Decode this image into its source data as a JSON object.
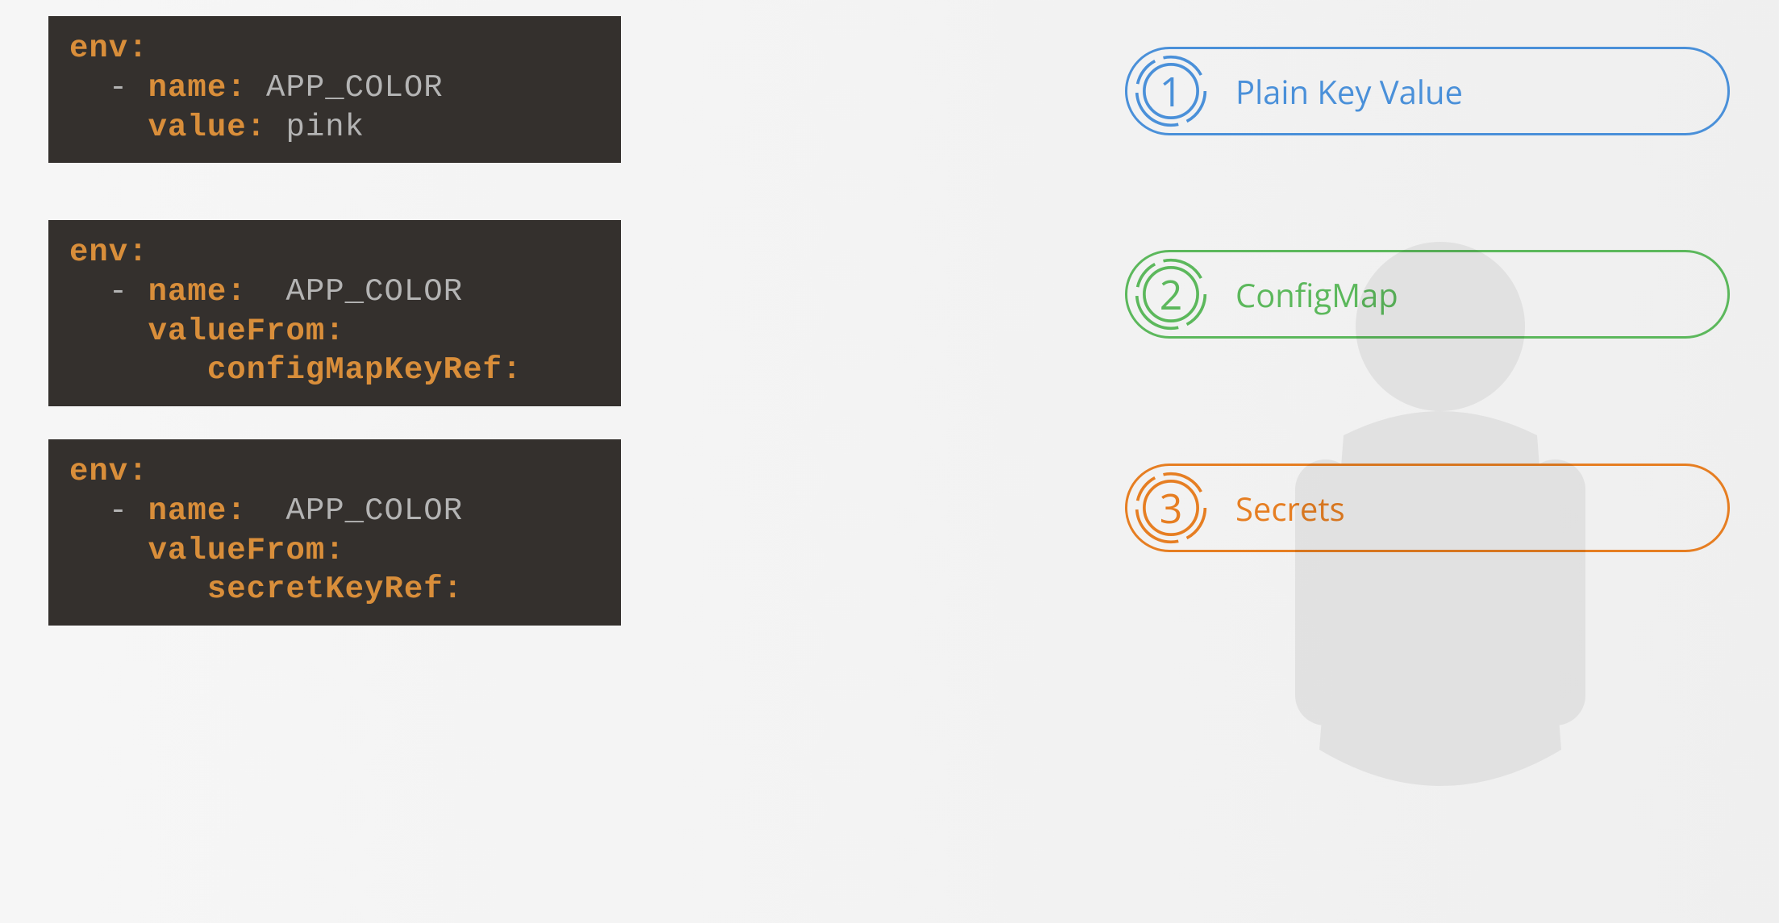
{
  "blocks": [
    {
      "lines": [
        {
          "segments": [
            {
              "cls": "k",
              "t": "env:"
            }
          ]
        },
        {
          "segments": [
            {
              "cls": "v",
              "t": "  - "
            },
            {
              "cls": "k",
              "t": "name:"
            },
            {
              "cls": "v",
              "t": " APP_COLOR"
            }
          ]
        },
        {
          "segments": [
            {
              "cls": "v",
              "t": "    "
            },
            {
              "cls": "k",
              "t": "value:"
            },
            {
              "cls": "v",
              "t": " pink"
            }
          ]
        }
      ]
    },
    {
      "lines": [
        {
          "segments": [
            {
              "cls": "k",
              "t": "env:"
            }
          ]
        },
        {
          "segments": [
            {
              "cls": "v",
              "t": "  - "
            },
            {
              "cls": "k",
              "t": "name:"
            },
            {
              "cls": "v",
              "t": "  APP_COLOR"
            }
          ]
        },
        {
          "segments": [
            {
              "cls": "v",
              "t": "    "
            },
            {
              "cls": "k",
              "t": "valueFrom:"
            }
          ]
        },
        {
          "segments": [
            {
              "cls": "v",
              "t": "       "
            },
            {
              "cls": "k",
              "t": "configMapKeyRef:"
            }
          ]
        }
      ]
    },
    {
      "lines": [
        {
          "segments": [
            {
              "cls": "k",
              "t": "env:"
            }
          ]
        },
        {
          "segments": [
            {
              "cls": "v",
              "t": "  - "
            },
            {
              "cls": "k",
              "t": "name:"
            },
            {
              "cls": "v",
              "t": "  APP_COLOR"
            }
          ]
        },
        {
          "segments": [
            {
              "cls": "v",
              "t": "    "
            },
            {
              "cls": "k",
              "t": "valueFrom:"
            }
          ]
        },
        {
          "segments": [
            {
              "cls": "v",
              "t": "       "
            },
            {
              "cls": "k",
              "t": "secretKeyRef:"
            }
          ]
        }
      ]
    }
  ],
  "pills": [
    {
      "num": "1",
      "label": "Plain Key Value",
      "color": "#4a90d9"
    },
    {
      "num": "2",
      "label": "ConfigMap",
      "color": "#5cb85c"
    },
    {
      "num": "3",
      "label": "Secrets",
      "color": "#e67e22"
    }
  ]
}
